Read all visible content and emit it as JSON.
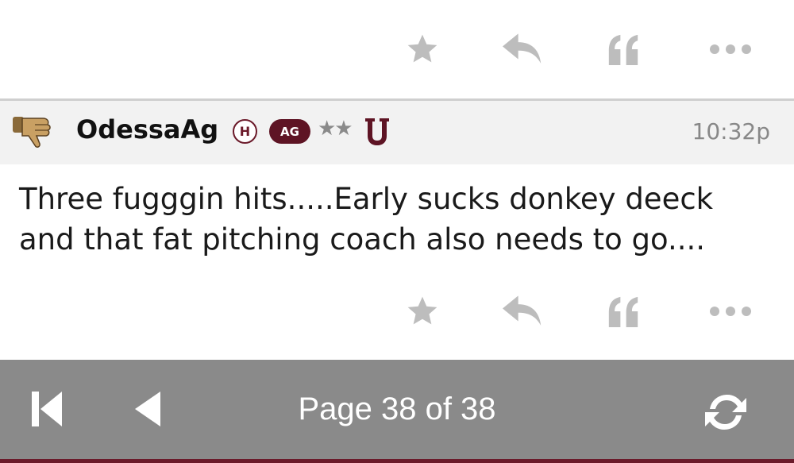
{
  "post": {
    "username": "OdessaAg",
    "badge_h": "H",
    "badge_ag": "AG",
    "stars": "★★",
    "timestamp": "10:32p",
    "body_line1": "Three fugggin hits.....Early sucks donkey deeck",
    "body_line2": "and that fat pitching coach also needs to go...."
  },
  "actions": {
    "icons": [
      "star-icon",
      "reply-icon",
      "quote-icon",
      "more-icon"
    ],
    "color": "#bdbdbd"
  },
  "pager": {
    "label": "Page 38 of 38",
    "background": "#8a8a8a",
    "accent": "#6b1a2a"
  }
}
